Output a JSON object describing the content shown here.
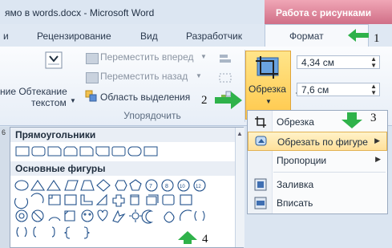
{
  "window": {
    "title": "ямо в words.docx - Microsoft Word",
    "context_tab": "Работа с рисунками"
  },
  "tabs": {
    "t0": "и",
    "t1": "Рецензирование",
    "t2": "Вид",
    "t3": "Разработчик",
    "format": "Формат"
  },
  "ribbon": {
    "wrap_text_line1": "ние Обтекание",
    "wrap_text_line2": "текстом",
    "bring_forward": "Переместить вперед",
    "send_backward": "Переместить назад",
    "selection_pane": "Область выделения",
    "arrange_group": "Упорядочить",
    "crop": "Обрезка",
    "height": "4,34 см",
    "width": "7,6 см"
  },
  "shapes_panel": {
    "ruler_mark": "6",
    "rectangles_title": "Прямоугольники",
    "basic_shapes_title": "Основные фигуры"
  },
  "crop_menu": {
    "items": [
      {
        "label": "Обрезка",
        "has_submenu": false
      },
      {
        "label": "Обрезать по фигуре",
        "has_submenu": true
      },
      {
        "label": "Пропорции",
        "has_submenu": true
      },
      {
        "label": "Заливка",
        "has_submenu": false
      },
      {
        "label": "Вписать",
        "has_submenu": false
      }
    ]
  },
  "annotations": {
    "step1": "1",
    "step2": "2",
    "step3": "3",
    "step4": "4",
    "arrow_color": "#2fb24a"
  }
}
